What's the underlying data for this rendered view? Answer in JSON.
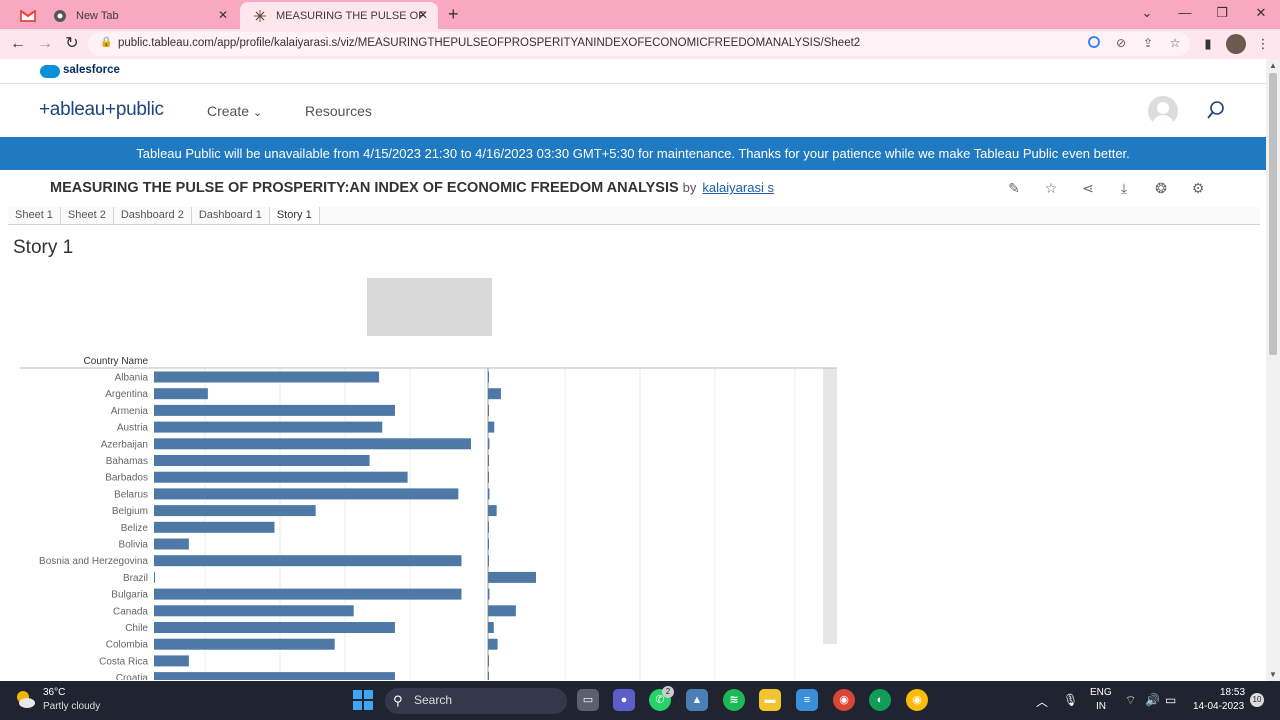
{
  "browser": {
    "tabs": [
      {
        "title": "New Tab"
      },
      {
        "title": "MEASURING THE PULSE OF PROSPERITY:AN INDEX OF ECONOMIC FREEDOM ANALYSIS"
      }
    ],
    "url": "public.tableau.com/app/profile/kalaiyarasi.s/viz/MEASURINGTHEPULSEOFPROSPERITYANINDEXOFECONOMICFREEDOMANALYSIS/Sheet2"
  },
  "salesforce": {
    "label": "salesforce"
  },
  "header": {
    "logo": "+ableau+public",
    "nav_create": "Create",
    "nav_resources": "Resources"
  },
  "banner": "Tableau Public will be unavailable from 4/15/2023 21:30 to 4/16/2023 03:30 GMT+5:30 for maintenance. Thanks for your patience while we make Tableau Public even better.",
  "viz": {
    "title": "MEASURING THE PULSE OF PROSPERITY:AN INDEX OF ECONOMIC FREEDOM ANALYSIS",
    "by": "by",
    "author": "kalaiyarasi s",
    "sheet_tabs": [
      "Sheet 1",
      "Sheet 2",
      "Dashboard 2",
      "Dashboard 1",
      "Story 1"
    ],
    "active_sheet": "Story 1",
    "story_title": "Story 1"
  },
  "chart_data": {
    "type": "bar",
    "column_header": "Country Name",
    "categories": [
      "Albania",
      "Argentina",
      "Armenia",
      "Austria",
      "Azerbaijan",
      "Bahamas",
      "Barbados",
      "Belarus",
      "Belgium",
      "Belize",
      "Bolivia",
      "Bosnia and Herzegovina",
      "Brazil",
      "Bulgaria",
      "Canada",
      "Chile",
      "Colombia",
      "Costa Rica",
      "Croatia"
    ],
    "series": [
      {
        "values": [
          0.71,
          0.17,
          0.76,
          0.72,
          1.0,
          0.68,
          0.8,
          0.96,
          0.51,
          0.38,
          0.11,
          0.97,
          0.0,
          0.97,
          0.63,
          0.76,
          0.57,
          0.11,
          0.76
        ]
      },
      {
        "values": [
          0.0,
          0.27,
          0.0,
          0.13,
          0.03,
          0.0,
          0.0,
          0.03,
          0.18,
          0.0,
          0.01,
          0.0,
          1.0,
          0.03,
          0.58,
          0.12,
          0.2,
          0.01,
          0.01
        ]
      }
    ],
    "colors": {
      "bar": "#4e79a7"
    }
  },
  "taskbar": {
    "weather_temp": "36°C",
    "weather_desc": "Partly cloudy",
    "search_label": "Search",
    "whatsapp_badge": "2",
    "lang_line1": "ENG",
    "lang_line2": "IN",
    "time": "18:53",
    "date": "14-04-2023",
    "notifications": "10"
  }
}
